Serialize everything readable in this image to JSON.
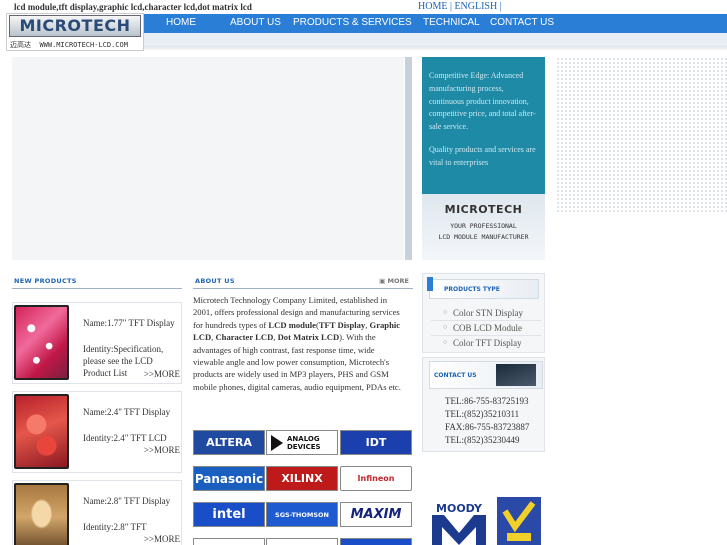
{
  "header": {
    "keywords": "lcd module,tft display,graphic lcd,character lcd,dot matrix lcd",
    "language_links": "HOME | ENGLISH |",
    "logo_text": "MICROTECH",
    "logo_chinese": "迈高达",
    "logo_url_text": "WWW.MICROTECH-LCD.COM"
  },
  "nav": {
    "items": [
      {
        "label": "HOME"
      },
      {
        "label": "ABOUT US"
      },
      {
        "label": "PRODUCTS & SERVICES"
      },
      {
        "label": "TECHNICAL"
      },
      {
        "label": "CONTACT US"
      }
    ]
  },
  "banner": {
    "slogan1": "Competitive Edge: Advanced manufacturing process, continuous product innovation, competitive price, and total after-sale service.",
    "slogan2": "Quality products and services are vital to enterprises",
    "brand": "MICROTECH",
    "tagline1": "YOUR PROFESSIONAL",
    "tagline2": "LCD MODULE MANUFACTURER"
  },
  "new_products": {
    "title": "NEW PRODUCTS",
    "items": [
      {
        "name": "Name:1.77\" TFT Display",
        "identity": "Identity:Specification, please see the LCD Product List",
        "more": ">>MORE"
      },
      {
        "name": "Name:2.4\" TFT Display",
        "identity": "Identity:2.4\" TFT LCD",
        "more": ">>MORE"
      },
      {
        "name": "Name:2.8\" TFT Display",
        "identity": "Identity:2.8\" TFT",
        "more": ">>MORE"
      }
    ]
  },
  "about": {
    "title": "ABOUT US",
    "more": "MORE",
    "text_intro": "Microtech Technology Company Limited, established in 2001, offers professional design and manufacturing services for hundreds types of ",
    "kw_lcd_module": "LCD module",
    "punct_paren_open": "(",
    "kw_tft": "TFT Display",
    "punct_comma": ", ",
    "kw_graphic": "Graphic LCD",
    "kw_character": "Character LCD",
    "kw_dotmatrix": "Dot Matrix LCD",
    "text_after": "). With the advantages of high contrast, fast response time, wide viewable angle and low power consumption, Microtech's products are widely used in MP3 players, PHS and GSM mobile phones, digital cameras, audio equipment, PDAs etc."
  },
  "partners": {
    "brands": [
      "ALTERA",
      "ANALOG DEVICES",
      "IDT",
      "Panasonic",
      "XILINX",
      "Infineon",
      "intel",
      "SGS-THOMSON",
      "MAXIM"
    ]
  },
  "product_type": {
    "title": "PRODUCTS TYPE",
    "items": [
      "Color STN Display",
      "COB LCD Module",
      "Color TFT Display"
    ]
  },
  "contact": {
    "title": "CONTACT US",
    "lines": [
      "TEL:86-755-83725193",
      "TEL:(852)35210311",
      "FAX:86-755-83723887",
      "TEL:(852)35230449"
    ]
  },
  "colors": {
    "nav_blue": "#2b7ed5",
    "accent_blue": "#1c63b5",
    "banner_teal": "#1e8aa6"
  }
}
